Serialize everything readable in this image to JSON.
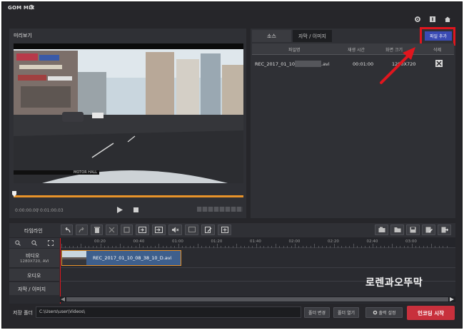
{
  "app": {
    "logo": "GOM MIX",
    "icons": [
      "gear-icon",
      "settings-icon",
      "info-icon",
      "home-icon"
    ]
  },
  "preview": {
    "title": "미리보기",
    "time_current": "0:00:00.00",
    "time_total": "0:01:00.03",
    "time_sep": "/",
    "video_overlay_label": "MOTOR HALL"
  },
  "source": {
    "tabs": [
      "소스",
      "자막 / 이미지"
    ],
    "add_file_label": "파일 추가",
    "columns": [
      "파일명",
      "재생 시간",
      "화면 크기",
      "삭제"
    ],
    "rows": [
      {
        "name": "REC_2017_01_10_",
        "ext": ".avi",
        "duration": "00:01:00",
        "size": "1280X720"
      }
    ]
  },
  "timeline": {
    "title": "타임라인",
    "ruler": [
      "00:20",
      "00:40",
      "01:00",
      "01:20",
      "01:40",
      "02:00",
      "02:20",
      "02:40",
      "03:00"
    ],
    "tracks": {
      "video": {
        "label": "비디오",
        "sub": "1280X720, AVI"
      },
      "audio": {
        "label": "오디오"
      },
      "subtitle": {
        "label": "자막 / 이미지"
      }
    },
    "clip": {
      "name": "REC_2017_01_10_08_38_10_D.avi"
    }
  },
  "watermark": "로렌과오뚜막",
  "bottom": {
    "save_folder_label": "저장 폴더",
    "save_path": "C:\\Users\\user\\Videos\\",
    "change_folder": "폴더 변경",
    "open_folder": "폴더 열기",
    "output_settings": "출력 설정",
    "encode": "인코딩 시작"
  },
  "colors": {
    "accent_orange": "#e8932a",
    "encode_red": "#c8303c",
    "highlight_red": "#e0161e",
    "add_file_blue": "#3a4bb4",
    "clip_blue": "#3e5f8c"
  }
}
